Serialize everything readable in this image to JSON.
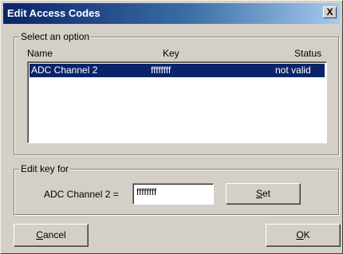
{
  "window": {
    "title": "Edit Access Codes",
    "close_label": "X"
  },
  "select_group": {
    "label": "Select an option",
    "columns": [
      "Name",
      "Key",
      "Status"
    ],
    "rows": [
      {
        "name": "ADC Channel 2",
        "key": "ffffffff",
        "status": "not valid",
        "selected": true
      }
    ]
  },
  "edit_group": {
    "label": "Edit key for",
    "field_label": "ADC Channel 2 =",
    "field_value": "ffffffff",
    "set_button": {
      "mnemonic": "S",
      "rest": "et"
    }
  },
  "footer": {
    "cancel_button": {
      "mnemonic": "C",
      "rest": "ancel"
    },
    "ok_button": {
      "mnemonic": "O",
      "rest": "K"
    }
  }
}
